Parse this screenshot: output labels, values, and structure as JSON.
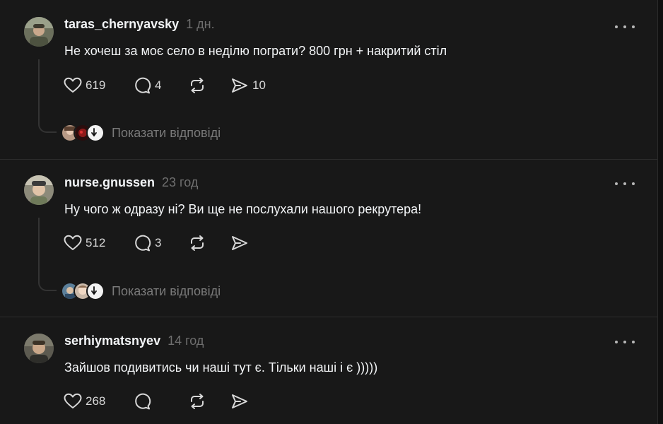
{
  "posts": [
    {
      "username": "taras_chernyavsky",
      "time": "1 дн.",
      "text": "Не хочеш за моє село в неділю пограти? 800 грн + накритий стіл",
      "likes": "619",
      "comments": "4",
      "shares": "10",
      "replies_label": "Показати відповіді"
    },
    {
      "username": "nurse.gnussen",
      "time": "23 год",
      "text": "Ну чого ж одразу ні? Ви ще не послухали нашого рекрутера!",
      "likes": "512",
      "comments": "3",
      "shares": "",
      "replies_label": "Показати відповіді"
    },
    {
      "username": "serhiymatsnyev",
      "time": "14 год",
      "text": "Зайшов подивитись чи наші тут є. Тільки наші і є )))))",
      "likes": "268",
      "comments": "",
      "shares": ""
    }
  ],
  "icons": {
    "like": "heart-icon",
    "comment": "comment-bubble-icon",
    "repost": "repost-icon",
    "share": "send-icon",
    "more": "more-horizontal-icon"
  },
  "colors": {
    "background": "#181818",
    "text": "#f3f5f7",
    "muted": "#6f6f6f"
  }
}
